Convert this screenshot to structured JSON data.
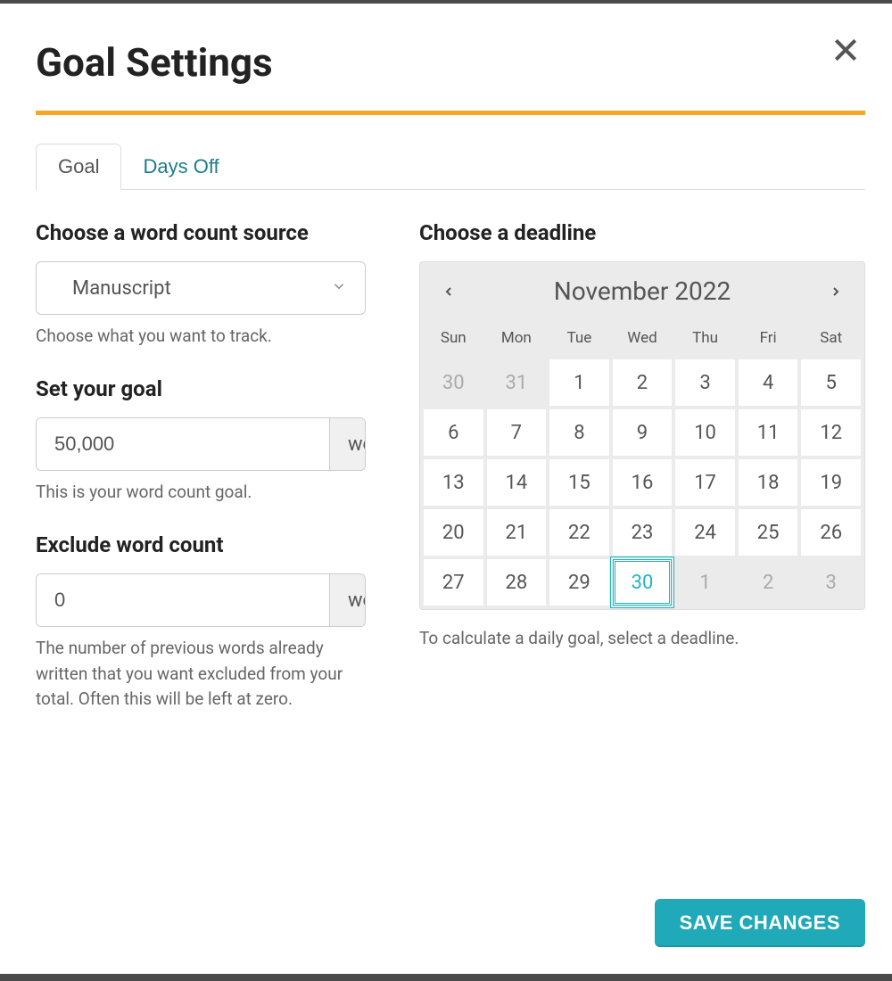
{
  "title": "Goal Settings",
  "tabs": {
    "goal": "Goal",
    "days_off": "Days Off"
  },
  "left": {
    "source": {
      "label": "Choose a word count source",
      "value": "Manuscript",
      "help": "Choose what you want to track."
    },
    "goal": {
      "label": "Set your goal",
      "value": "50,000",
      "unit": "words",
      "help": "This is your word count goal."
    },
    "exclude": {
      "label": "Exclude word count",
      "value": "0",
      "unit": "words",
      "help": "The number of previous words already written that you want excluded from your total. Often this will be left at zero."
    }
  },
  "right": {
    "deadline_label": "Choose a deadline",
    "month_label": "November 2022",
    "day_headers": [
      "Sun",
      "Mon",
      "Tue",
      "Wed",
      "Thu",
      "Fri",
      "Sat"
    ],
    "weeks": [
      [
        {
          "n": "30",
          "other": true
        },
        {
          "n": "31",
          "other": true
        },
        {
          "n": "1"
        },
        {
          "n": "2"
        },
        {
          "n": "3"
        },
        {
          "n": "4"
        },
        {
          "n": "5"
        }
      ],
      [
        {
          "n": "6"
        },
        {
          "n": "7"
        },
        {
          "n": "8"
        },
        {
          "n": "9"
        },
        {
          "n": "10"
        },
        {
          "n": "11"
        },
        {
          "n": "12"
        }
      ],
      [
        {
          "n": "13"
        },
        {
          "n": "14"
        },
        {
          "n": "15"
        },
        {
          "n": "16"
        },
        {
          "n": "17"
        },
        {
          "n": "18"
        },
        {
          "n": "19"
        }
      ],
      [
        {
          "n": "20"
        },
        {
          "n": "21"
        },
        {
          "n": "22"
        },
        {
          "n": "23"
        },
        {
          "n": "24"
        },
        {
          "n": "25"
        },
        {
          "n": "26"
        }
      ],
      [
        {
          "n": "27"
        },
        {
          "n": "28"
        },
        {
          "n": "29"
        },
        {
          "n": "30",
          "selected": true
        },
        {
          "n": "1",
          "other": true
        },
        {
          "n": "2",
          "other": true
        },
        {
          "n": "3",
          "other": true
        }
      ]
    ],
    "deadline_help": "To calculate a daily goal, select a deadline."
  },
  "footer": {
    "save": "SAVE CHANGES"
  }
}
